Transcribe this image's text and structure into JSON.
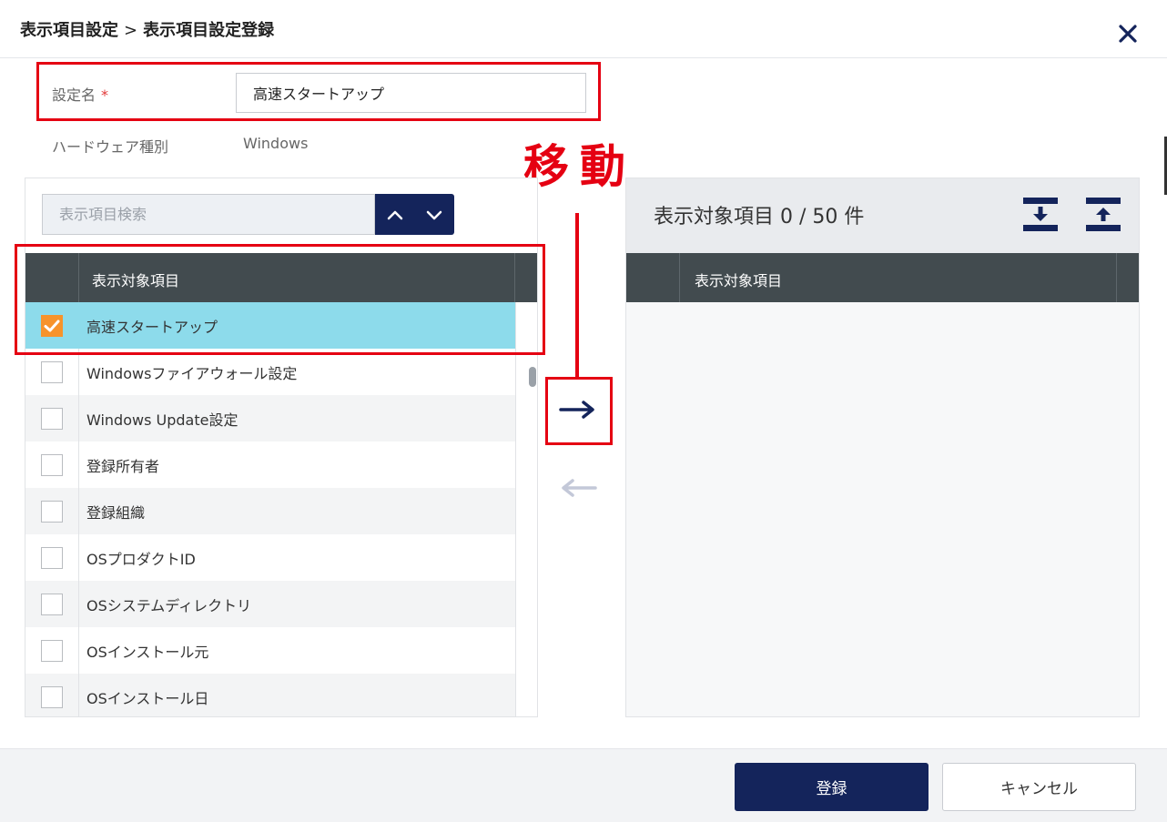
{
  "header": {
    "breadcrumb_parent": "表示項目設定",
    "breadcrumb_separator": ">",
    "breadcrumb_current": "表示項目設定登録"
  },
  "form": {
    "name_label": "設定名",
    "name_required_mark": "*",
    "name_value": "高速スタートアップ",
    "hardware_label": "ハードウェア種別",
    "hardware_value": "Windows"
  },
  "annotation": {
    "text": "移動",
    "color": "#e50012"
  },
  "left_panel": {
    "search_placeholder": "表示項目検索",
    "column_header": "表示対象項目",
    "items": [
      {
        "label": "高速スタートアップ",
        "checked": true
      },
      {
        "label": "Windowsファイアウォール設定",
        "checked": false
      },
      {
        "label": "Windows Update設定",
        "checked": false
      },
      {
        "label": "登録所有者",
        "checked": false
      },
      {
        "label": "登録組織",
        "checked": false
      },
      {
        "label": "OSプロダクトID",
        "checked": false
      },
      {
        "label": "OSシステムディレクトリ",
        "checked": false
      },
      {
        "label": "OSインストール元",
        "checked": false
      },
      {
        "label": "OSインストール日",
        "checked": false
      }
    ]
  },
  "right_panel": {
    "title": "表示対象項目 0 / 50 件",
    "column_header": "表示対象項目"
  },
  "footer": {
    "register_label": "登録",
    "cancel_label": "キャンセル"
  },
  "colors": {
    "primary": "#14245b",
    "selected_row": "#8ddbeb",
    "checkbox_checked": "#f7932b",
    "table_header": "#424b4f"
  }
}
